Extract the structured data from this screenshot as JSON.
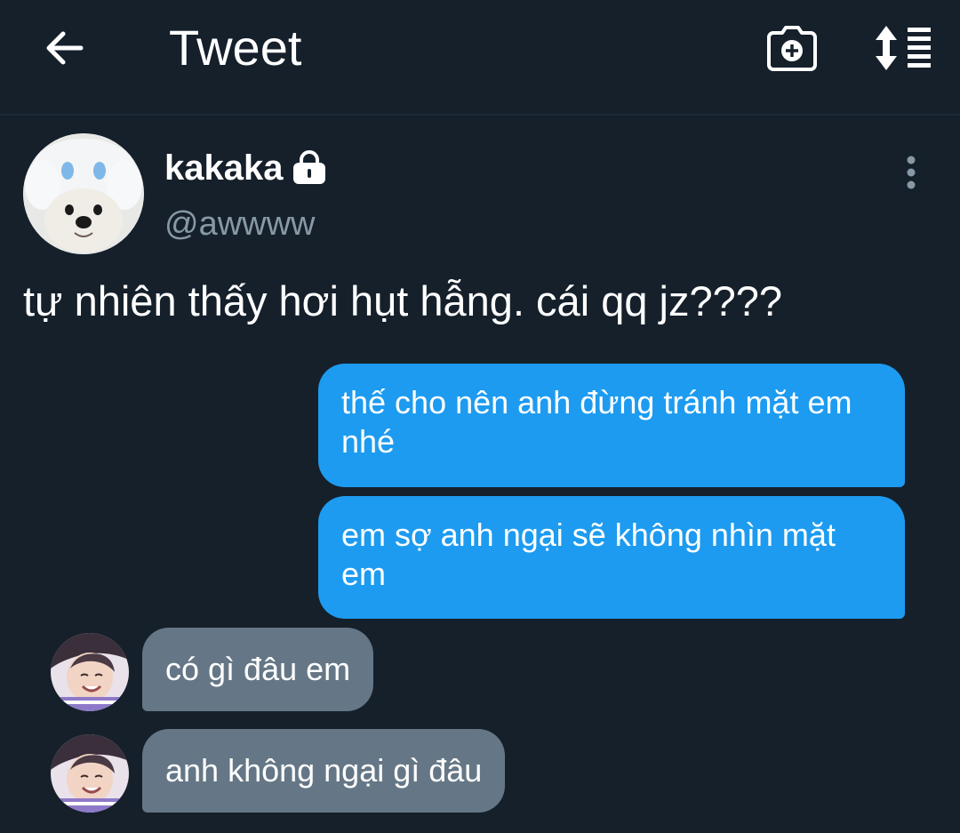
{
  "header": {
    "title": "Tweet",
    "back_icon": "arrow-left-icon",
    "camera_icon": "camera-add-icon",
    "sort_icon": "sort-list-icon"
  },
  "tweet": {
    "display_name": "kakaka",
    "protected_icon": "lock-icon",
    "handle": "@awwww",
    "more_icon": "more-vertical-icon",
    "text": "tự nhiên thấy hơi hụt hẫng. cái qq jz????"
  },
  "chat": {
    "outgoing": [
      "thế cho nên anh đừng tránh mặt em nhé",
      "em sợ anh ngại sẽ không nhìn mặt em"
    ],
    "incoming": [
      "có gì đâu em",
      "anh không ngại gì đâu"
    ]
  },
  "colors": {
    "background": "#15202b",
    "outgoing_bubble": "#1d9bf0",
    "incoming_bubble": "#657786",
    "secondary_text": "#8899a6"
  }
}
